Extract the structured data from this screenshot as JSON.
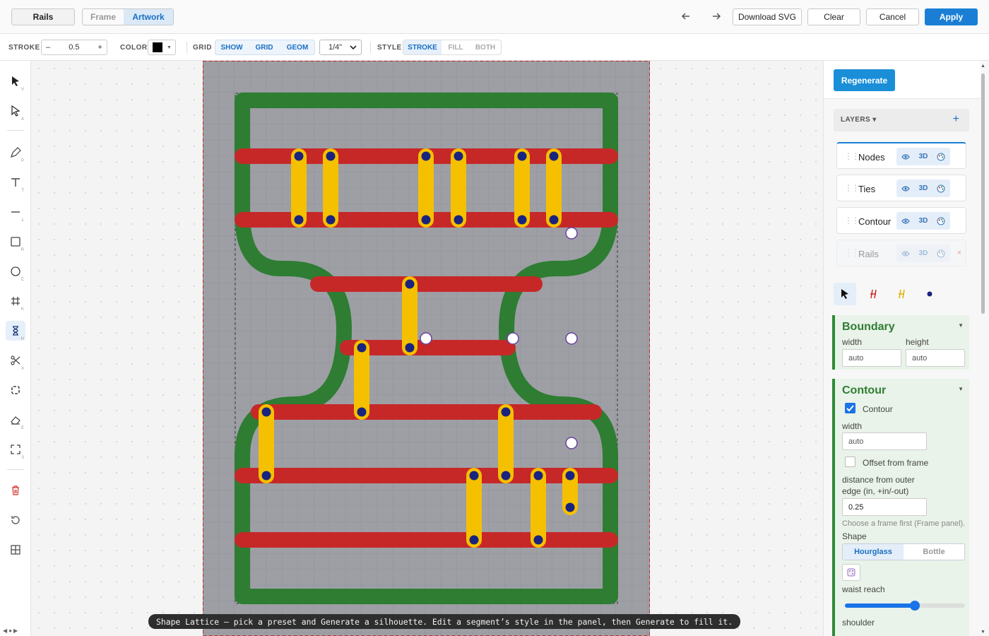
{
  "topbar": {
    "rails_label": "Rails",
    "tabs": [
      {
        "label": "Frame",
        "active": false
      },
      {
        "label": "Artwork",
        "active": true
      }
    ],
    "undo_icon": "arrow-left-icon",
    "redo_icon": "arrow-right-icon",
    "download_label": "Download SVG",
    "clear_label": "Clear",
    "cancel_label": "Cancel",
    "apply_label": "Apply"
  },
  "toolbar": {
    "stroke_label": "STROKE",
    "stroke_minus": "–",
    "stroke_value": "0.5",
    "stroke_plus": "+",
    "color_label": "COLOR",
    "color_value": "#000000",
    "grid_label": "GRID",
    "grid_options": [
      "SHOW",
      "GRID",
      "GEOM"
    ],
    "grid_size": "1/4\"",
    "style_label": "STYLE",
    "style_options": [
      {
        "label": "STROKE",
        "active": true
      },
      {
        "label": "FILL",
        "active": false
      },
      {
        "label": "BOTH",
        "active": false
      }
    ]
  },
  "tools": [
    {
      "name": "select-tool",
      "icon": "arrow-icon",
      "key": "V"
    },
    {
      "name": "direct-select-tool",
      "icon": "hollow-arrow-icon",
      "key": "A"
    },
    {
      "name": "pen-tool",
      "icon": "pen-icon",
      "key": "P"
    },
    {
      "name": "text-tool",
      "icon": "text-icon",
      "key": "T"
    },
    {
      "name": "line-tool",
      "icon": "line-icon",
      "key": "L"
    },
    {
      "name": "rect-tool",
      "icon": "square-icon",
      "key": "R"
    },
    {
      "name": "circle-tool",
      "icon": "circle-icon",
      "key": "C"
    },
    {
      "name": "grid-tool",
      "icon": "hash-icon",
      "key": "K"
    },
    {
      "name": "hourglass-tool",
      "icon": "hourglass-icon",
      "key": "H",
      "active": true
    },
    {
      "name": "scissors-tool",
      "icon": "scissors-icon",
      "key": "X"
    },
    {
      "name": "frame-tool",
      "icon": "frame-icon",
      "key": ""
    },
    {
      "name": "eraser-tool",
      "icon": "eraser-icon",
      "key": "E"
    },
    {
      "name": "fit-tool",
      "icon": "expand-icon",
      "key": "0"
    }
  ],
  "canvas": {
    "hint": "Shape Lattice — pick a preset and Generate a silhouette. Edit a segment’s style in the panel, then Generate to fill it.",
    "colors": {
      "contour": "#2e7d32",
      "rail": "#c62828",
      "tie": "#f5c000",
      "node": "#1a237e"
    }
  },
  "panel": {
    "regenerate_label": "Regenerate",
    "layers_label": "LAYERS ▾",
    "add_label": "+",
    "layers": [
      {
        "name": "Nodes",
        "tag3d": "3D",
        "dim": false
      },
      {
        "name": "Ties",
        "tag3d": "3D",
        "dim": false
      },
      {
        "name": "Contour",
        "tag3d": "3D",
        "dim": false
      },
      {
        "name": "Rails",
        "tag3d": "3D",
        "dim": true,
        "remove": "×"
      }
    ],
    "boundary": {
      "title": "Boundary",
      "width_label": "width",
      "height_label": "height",
      "width_value": "auto",
      "height_value": "auto"
    },
    "contour": {
      "title": "Contour",
      "checkbox_label": "Contour",
      "checked": true,
      "width_label": "width",
      "width_value": "auto",
      "offset_label": "Offset from frame",
      "distance_label_1": "distance from outer",
      "distance_label_2": "edge (in, +in/-out)",
      "distance_value": "0.25",
      "note": "Choose a frame first (Frame panel).",
      "shape_label": "Shape",
      "shapes": [
        {
          "label": "Hourglass",
          "active": true
        },
        {
          "label": "Bottle",
          "active": false
        }
      ],
      "waist_label": "waist reach",
      "waist_value": 0.58,
      "shoulder_label": "shoulder"
    }
  }
}
